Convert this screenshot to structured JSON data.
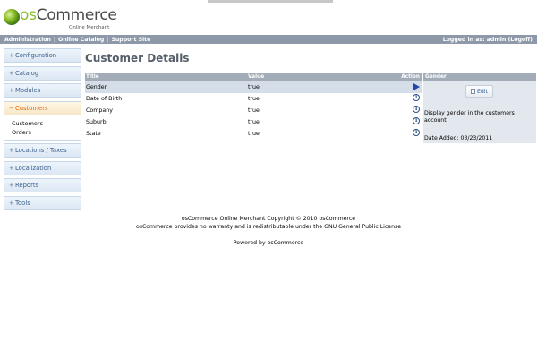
{
  "brand": {
    "name_prefix": "os",
    "name_suffix": "Commerce",
    "tagline": "Online Merchant"
  },
  "navbar": {
    "links": [
      "Administration",
      "Online Catalog",
      "Support Site"
    ],
    "login_text": "Logged in as: admin (Logoff)"
  },
  "sidebar": {
    "items_top": [
      {
        "sign": "+",
        "label": "Configuration"
      },
      {
        "sign": "+",
        "label": "Catalog"
      },
      {
        "sign": "+",
        "label": "Modules"
      }
    ],
    "open_section": {
      "sign": "−",
      "label": "Customers",
      "children": [
        "Customers",
        "Orders"
      ]
    },
    "items_bottom": [
      {
        "sign": "+",
        "label": "Locations / Taxes"
      },
      {
        "sign": "+",
        "label": "Localization"
      },
      {
        "sign": "+",
        "label": "Reports"
      },
      {
        "sign": "+",
        "label": "Tools"
      }
    ]
  },
  "page": {
    "title": "Customer Details"
  },
  "table": {
    "headers": {
      "title": "Title",
      "value": "Value",
      "action": "Action"
    },
    "rows": [
      {
        "title": "Gender",
        "value": "true",
        "icon": "play-arrow-icon",
        "selected": true
      },
      {
        "title": "Date of Birth",
        "value": "true",
        "icon": "info-icon",
        "selected": false
      },
      {
        "title": "Company",
        "value": "true",
        "icon": "info-icon",
        "selected": false
      },
      {
        "title": "Suburb",
        "value": "true",
        "icon": "info-icon",
        "selected": false
      },
      {
        "title": "State",
        "value": "true",
        "icon": "info-icon",
        "selected": false
      }
    ]
  },
  "info_panel": {
    "header": "Gender",
    "edit_label": "Edit",
    "description": "Display gender in the customers account",
    "date_added": "Date Added: 03/23/2011"
  },
  "footer": {
    "line1": "osCommerce Online Merchant Copyright © 2010 osCommerce",
    "line2": "osCommerce provides no warranty and is redistributable under the GNU General Public License",
    "powered": "Powered by osCommerce"
  },
  "colors": {
    "navbar_bg": "#8d99a8",
    "accent_orange": "#e0650d",
    "link_blue": "#3a5f8c",
    "selected_row": "#d4dde8"
  }
}
